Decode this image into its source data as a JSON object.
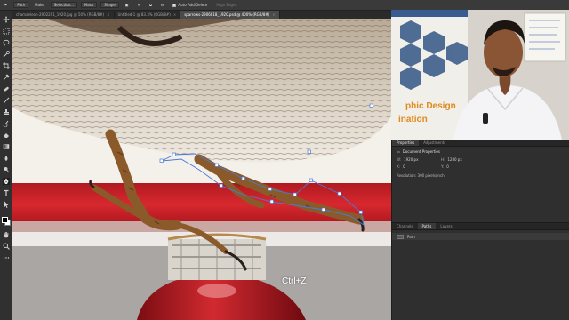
{
  "options_bar": {
    "path_label": "Path",
    "make_label": "Make",
    "selection_label": "Selection...",
    "mask_label": "Mask",
    "shape_label": "Shape",
    "auto_add_delete_label": "Auto Add/Delete",
    "align_edges_label": "Align Edges"
  },
  "tabs": [
    {
      "label": "chamaeleon-2902291_1920.jpg @ 50% (RGB/8#)"
    },
    {
      "label": "Untitled-1 @ 83.3% (RGB/8#)"
    },
    {
      "label": "sparrows-2906818_1920.psd @ 400% (RGB/8#)"
    }
  ],
  "canvas": {
    "overlay_text": "Ctrl+Z"
  },
  "webcam": {
    "banner_line1": "phic Design",
    "banner_line2": "ination"
  },
  "properties": {
    "tabs": [
      "Properties",
      "Adjustments"
    ],
    "title": "Document Properties",
    "w_label": "W:",
    "w_value": "1920 px",
    "h_label": "H:",
    "h_value": "1280 px",
    "x_label": "X:",
    "x_value": "0",
    "y_label": "Y:",
    "y_value": "0",
    "resolution": "Resolution: 300 pixels/inch"
  },
  "layers_panel": {
    "tabs": [
      "Channels",
      "Paths",
      "Layers"
    ],
    "path_name": "Path"
  },
  "colors": {
    "accent_orange": "#e08a1d",
    "canvas_red": "#c8232b",
    "path_blue": "#4a7ad8"
  }
}
